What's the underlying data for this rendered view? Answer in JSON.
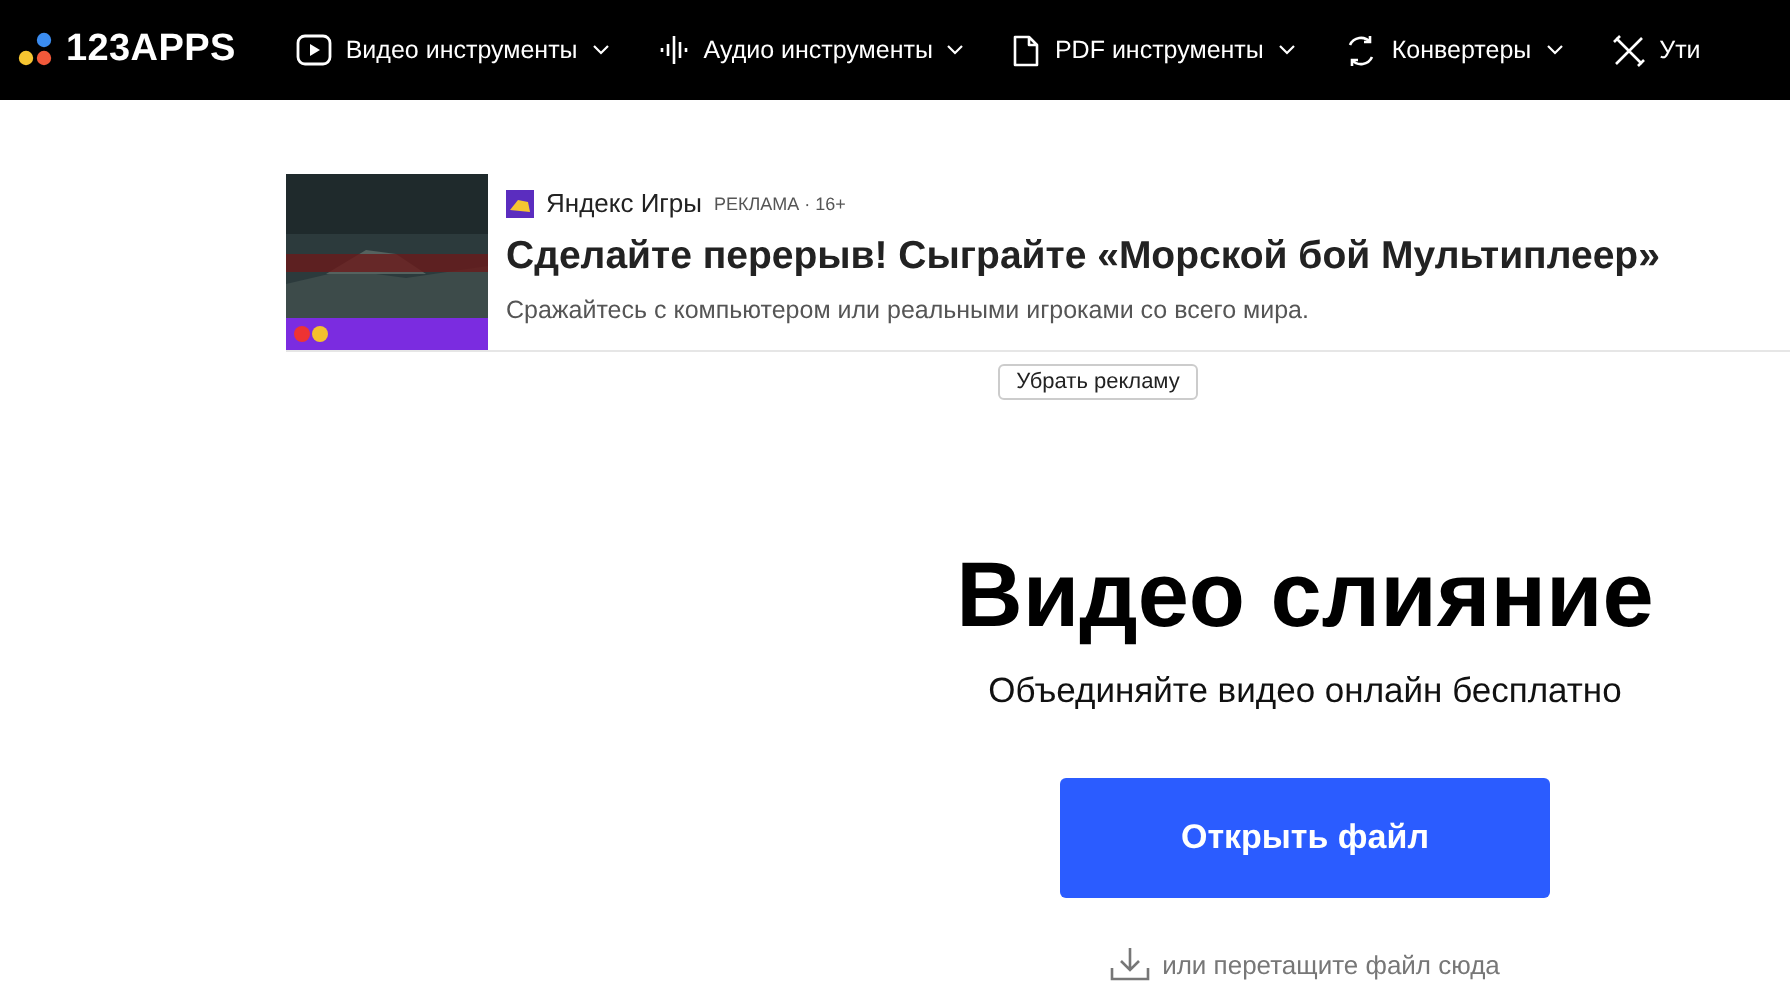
{
  "header": {
    "logo": "123APPS",
    "nav": [
      {
        "label": "Видео инструменты",
        "dropdown": true
      },
      {
        "label": "Аудио инструменты",
        "dropdown": true
      },
      {
        "label": "PDF инструменты",
        "dropdown": true
      },
      {
        "label": "Конвертеры",
        "dropdown": true
      },
      {
        "label": "Ути",
        "dropdown": false
      }
    ]
  },
  "ad": {
    "source": "Яндекс Игры",
    "badge": "РЕКЛАМА · 16+",
    "title": "Сделайте перерыв! Сыграйте «Морской бой Мультиплеер»",
    "description": "Сражайтесь с компьютером или реальными игроками со всего мира.",
    "remove_button": "Убрать рекламу"
  },
  "main": {
    "title": "Видео слияние",
    "subtitle": "Объединяйте видео онлайн бесплатно",
    "open_button": "Открыть файл",
    "drop_hint": "или перетащите файл сюда"
  }
}
